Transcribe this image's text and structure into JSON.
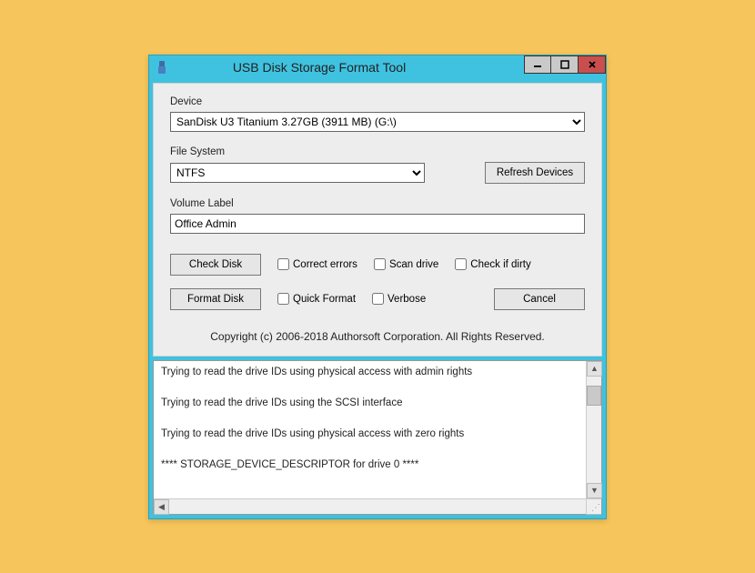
{
  "window": {
    "title": "USB Disk Storage Format Tool"
  },
  "labels": {
    "device": "Device",
    "filesystem": "File System",
    "volume": "Volume Label"
  },
  "device": {
    "selected": "SanDisk U3 Titanium 3.27GB (3911 MB)  (G:\\)"
  },
  "filesystem": {
    "selected": "NTFS"
  },
  "volume": {
    "value": "Office Admin"
  },
  "buttons": {
    "refresh": "Refresh Devices",
    "checkdisk": "Check Disk",
    "formatdisk": "Format Disk",
    "cancel": "Cancel"
  },
  "checks": {
    "correct": "Correct errors",
    "scan": "Scan drive",
    "dirty": "Check if dirty",
    "quick": "Quick Format",
    "verbose": "Verbose"
  },
  "copyright": "Copyright (c) 2006-2018 Authorsoft Corporation. All Rights Reserved.",
  "log": {
    "lines": [
      "Trying to read the drive IDs using physical access with admin rights",
      "Trying to read the drive IDs using the SCSI interface",
      "Trying to read the drive IDs using physical access with zero rights",
      "**** STORAGE_DEVICE_DESCRIPTOR for drive 0 ****"
    ]
  }
}
